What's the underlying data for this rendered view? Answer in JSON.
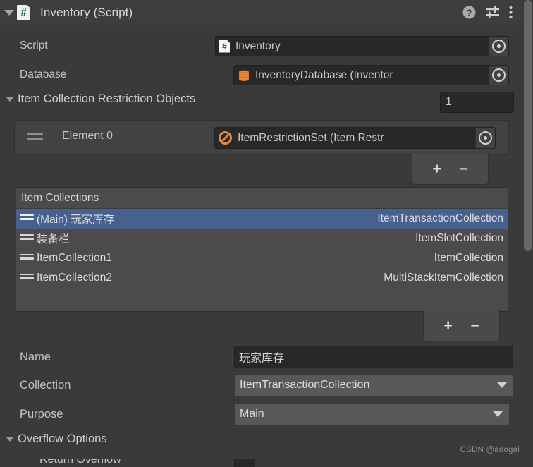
{
  "component": {
    "title": "Inventory (Script)",
    "script_badge_glyph": "#",
    "icons": {
      "foldout": "triangle-down-icon",
      "help": "help-icon",
      "preset": "preset-slider-icon",
      "menu": "kebab-menu-icon"
    }
  },
  "fields": {
    "script": {
      "label": "Script",
      "value": "Inventory",
      "icon": "csharp-script-icon",
      "picker": "object-picker-icon"
    },
    "database": {
      "label": "Database",
      "value": "InventoryDatabase (Inventor",
      "icon": "database-icon",
      "picker": "object-picker-icon"
    }
  },
  "restriction_objects": {
    "label": "Item Collection Restriction Objects",
    "size": "1",
    "element": {
      "label": "Element 0",
      "value": "ItemRestrictionSet (Item Restr",
      "icon": "no-entry-icon",
      "picker": "object-picker-icon"
    },
    "add_label": "+",
    "remove_label": "–"
  },
  "item_collections": {
    "header": "Item Collections",
    "rows": [
      {
        "name": "(Main) 玩家库存",
        "type": "ItemTransactionCollection",
        "selected": true
      },
      {
        "name": "装备栏",
        "type": "ItemSlotCollection",
        "selected": false
      },
      {
        "name": "ItemCollection1",
        "type": "ItemCollection",
        "selected": false
      },
      {
        "name": "ItemCollection2",
        "type": "MultiStackItemCollection",
        "selected": false
      }
    ],
    "add_label": "+",
    "remove_label": "–"
  },
  "details": {
    "name": {
      "label": "Name",
      "value": "玩家库存"
    },
    "collection": {
      "label": "Collection",
      "value": "ItemTransactionCollection"
    },
    "purpose": {
      "label": "Purpose",
      "value": "Main"
    }
  },
  "overflow_options": {
    "label": "Overflow Options",
    "cut_row_label": "Return Overflow"
  },
  "watermark": "CSDN @adogai",
  "colors": {
    "background": "#3a3a3a",
    "selection_blue": "#46618f",
    "field_dark": "#282828",
    "dropdown_gray": "#585858",
    "list_gray": "#4b4b4b",
    "accent_orange": "#e8873a",
    "script_green": "#17682f"
  }
}
